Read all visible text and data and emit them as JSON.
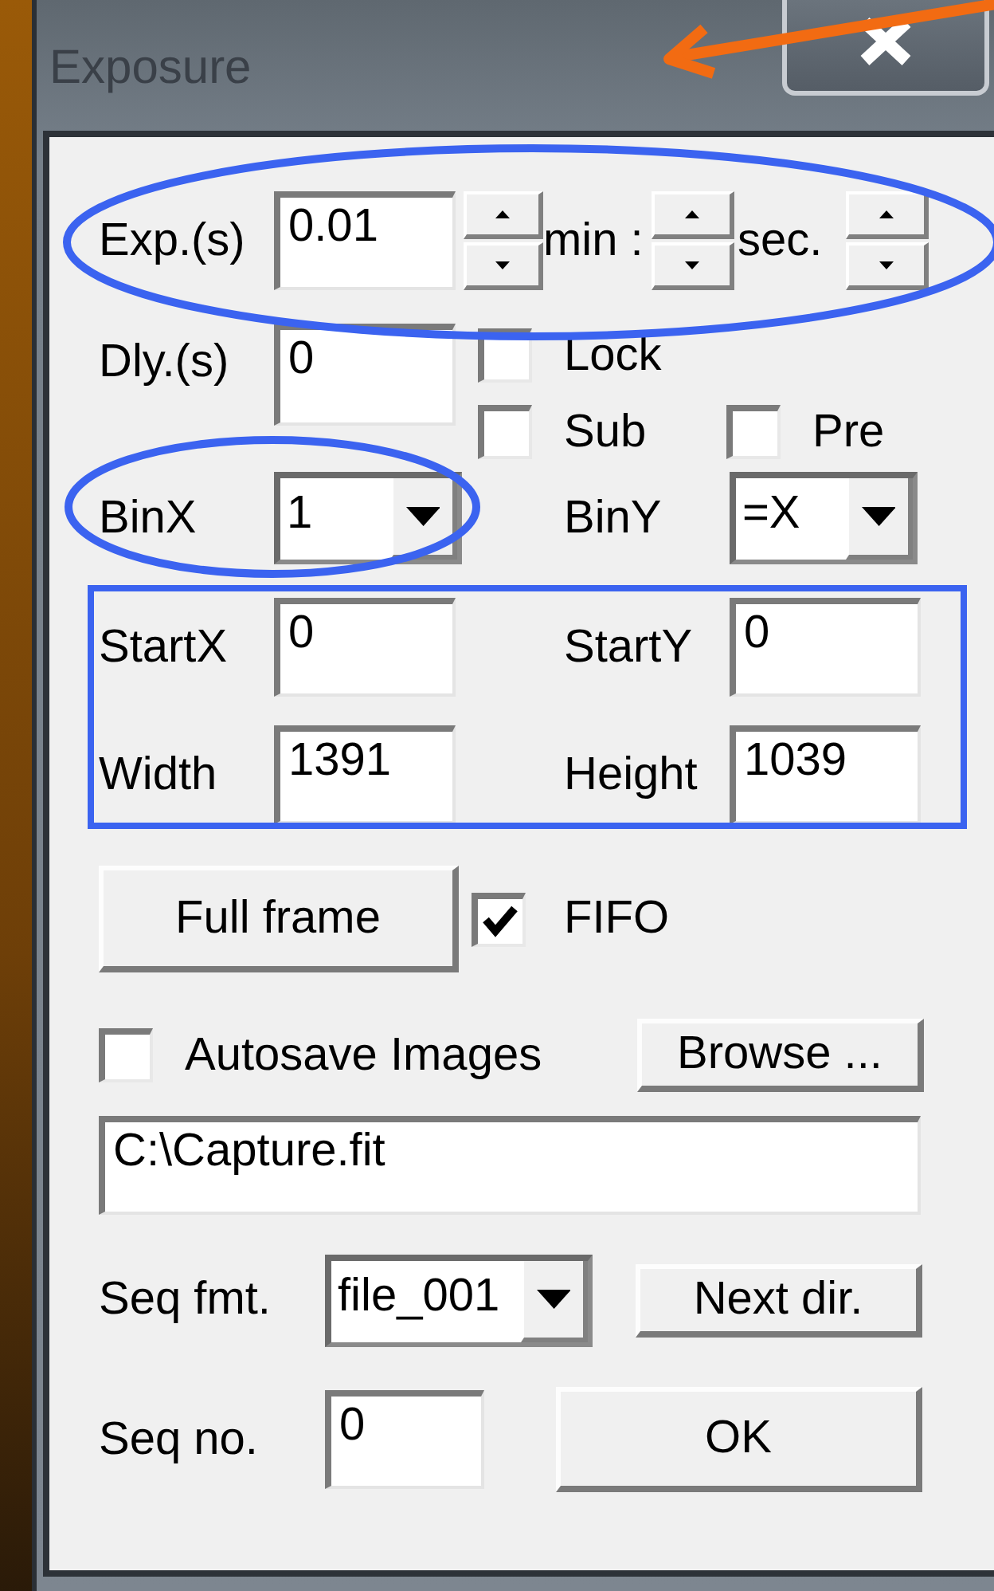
{
  "window": {
    "title": "Exposure"
  },
  "exposure": {
    "label": "Exp.(s)",
    "value": "0.01",
    "min_label": "min :",
    "sec_label": "sec."
  },
  "delay": {
    "label": "Dly.(s)",
    "value": "0"
  },
  "checkboxes": [
    {
      "label": "Lock",
      "checked": false
    },
    {
      "label": "Sub",
      "checked": false
    },
    {
      "label": "Pre",
      "checked": false
    }
  ],
  "binning": [
    {
      "label": "BinX",
      "value": "1"
    },
    {
      "label": "BinY",
      "value": "=X"
    }
  ],
  "region": [
    {
      "label": "StartX",
      "value": "0"
    },
    {
      "label": "StartY",
      "value": "0"
    },
    {
      "label": "Width",
      "value": "1391"
    },
    {
      "label": "Height",
      "value": "1039"
    }
  ],
  "full_frame_button": "Full frame",
  "fifo": {
    "label": "FIFO",
    "checked": true
  },
  "autosave": {
    "label": "Autosave Images",
    "checked": false
  },
  "browse_button": "Browse ...",
  "path": "C:\\Capture.fit",
  "seq_format": {
    "label": "Seq fmt.",
    "value": "file_001"
  },
  "next_dir_button": "Next dir.",
  "seq_no": {
    "label": "Seq no.",
    "value": "0"
  },
  "ok_button": "OK",
  "annotations": [
    {
      "kind": "arrow",
      "color": "#f26b12"
    },
    {
      "kind": "ellipse",
      "color": "#3b63f0"
    },
    {
      "kind": "ellipse",
      "color": "#3b63f0"
    },
    {
      "kind": "rectangle",
      "color": "#3b63f0"
    }
  ]
}
